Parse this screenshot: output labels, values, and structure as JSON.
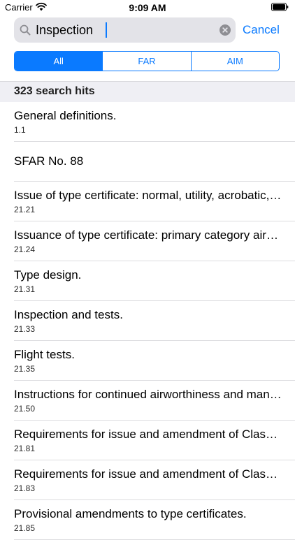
{
  "status_bar": {
    "carrier": "Carrier",
    "time": "9:09 AM"
  },
  "search": {
    "value": "Inspection",
    "cancel_label": "Cancel"
  },
  "segments": [
    {
      "label": "All",
      "selected": true
    },
    {
      "label": "FAR",
      "selected": false
    },
    {
      "label": "AIM",
      "selected": false
    }
  ],
  "results_header": "323 search hits",
  "results": [
    {
      "title": "General definitions.",
      "ref": "1.1"
    },
    {
      "title": "SFAR No. 88",
      "ref": ""
    },
    {
      "title": "Issue of type certificate: normal, utility, acrobatic, commuter, and transport category aircraft; manned free balloons; special classes of aircraft; aircraft engines; propellers.",
      "ref": "21.21"
    },
    {
      "title": "Issuance of type certificate: primary category aircraft.",
      "ref": "21.24"
    },
    {
      "title": "Type design.",
      "ref": "21.31"
    },
    {
      "title": "Inspection and tests.",
      "ref": "21.33"
    },
    {
      "title": "Flight tests.",
      "ref": "21.35"
    },
    {
      "title": "Instructions for continued airworthiness and manufacturer's maintenance manuals having airworthiness limitations sections.",
      "ref": "21.50"
    },
    {
      "title": "Requirements for issue and amendment of Class I type certificates.",
      "ref": "21.81"
    },
    {
      "title": "Requirements for issue and amendment of Class II type certificates.",
      "ref": "21.83"
    },
    {
      "title": "Provisional amendments to type certificates.",
      "ref": "21.85"
    }
  ],
  "colors": {
    "accent": "#0a7aff",
    "header_bg": "#efeff4",
    "search_bg": "#e3e3e8"
  },
  "icons": [
    "wifi-icon",
    "battery-icon",
    "search-icon",
    "clear-icon"
  ]
}
